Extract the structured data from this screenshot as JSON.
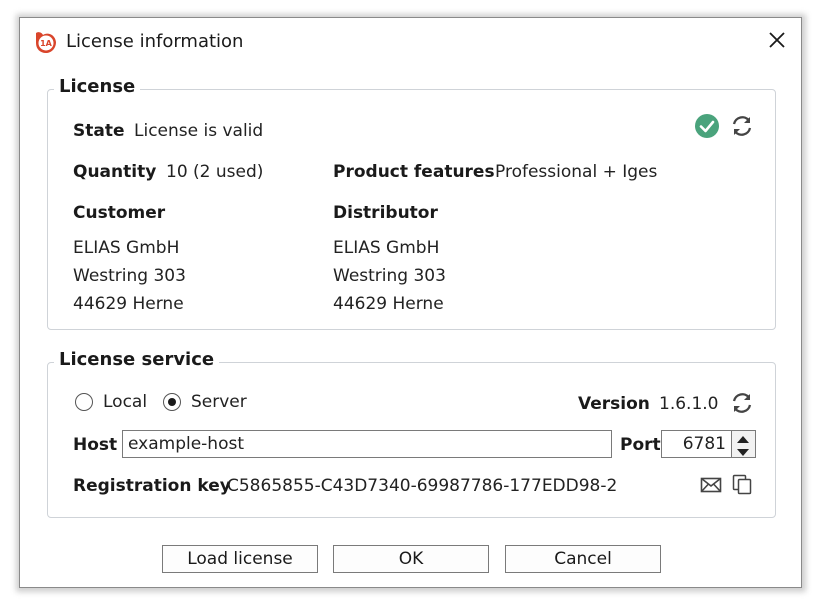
{
  "window": {
    "title": "License information",
    "app_icon": "app-logo-icon",
    "close_icon": "close-icon"
  },
  "license": {
    "group_title": "License",
    "state_label": "State",
    "state_value": "License is valid",
    "status_icon": "check-circle-icon",
    "refresh_icon": "refresh-icon",
    "quantity_label": "Quantity",
    "quantity_value": "10 (2 used)",
    "features_label": "Product features",
    "features_value": "Professional + Iges",
    "customer": {
      "label": "Customer",
      "lines": [
        "ELIAS GmbH",
        "Westring 303",
        "44629 Herne"
      ]
    },
    "distributor": {
      "label": "Distributor",
      "lines": [
        "ELIAS GmbH",
        "Westring 303",
        "44629 Herne"
      ]
    }
  },
  "service": {
    "group_title": "License service",
    "radio_local": "Local",
    "radio_server": "Server",
    "selected": "Server",
    "version_label": "Version",
    "version_value": "1.6.1.0",
    "host_label": "Host",
    "host_value": "example-host",
    "port_label": "Port",
    "port_value": "6781",
    "regkey_label": "Registration key",
    "regkey_value": "C5865855-C43D7340-69987786-177EDD98-2",
    "mail_icon": "envelope-icon",
    "copy_icon": "copy-icon"
  },
  "buttons": {
    "load": "Load license",
    "ok": "OK",
    "cancel": "Cancel"
  },
  "colors": {
    "accent_green": "#4aa37c",
    "logo_red": "#d9452b"
  }
}
